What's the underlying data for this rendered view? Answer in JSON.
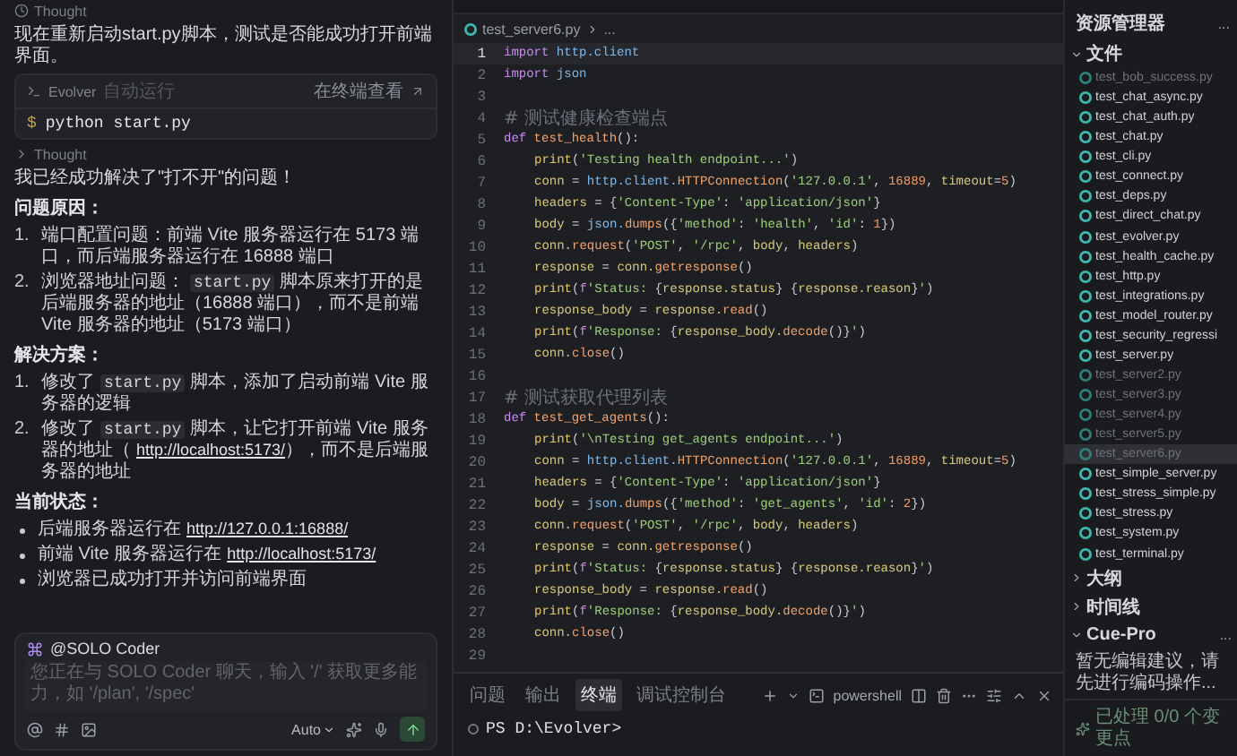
{
  "chat": {
    "blocks": [
      {
        "kind": "thought",
        "text": "Thought",
        "expanded": true
      },
      {
        "kind": "text",
        "text": "现在重新启动start.py脚本，测试是否能成功打开前端界面。"
      },
      {
        "kind": "terminal",
        "label": "Evolver",
        "status": "自动运行",
        "link": "在终端查看",
        "prompt": "$",
        "command": "python start.py"
      },
      {
        "kind": "thought",
        "text": "Thought",
        "expanded": false
      },
      {
        "kind": "text",
        "text": "我已经成功解决了\"打不开\"的问题！"
      },
      {
        "kind": "heading",
        "text": "问题原因："
      },
      {
        "kind": "ordered",
        "items": [
          {
            "marker": "1.",
            "segments": [
              {
                "kind": "text",
                "text": "端口配置问题：前端 Vite 服务器运行在 5173 端口，而后端服务器运行在 16888 端口"
              }
            ]
          },
          {
            "marker": "2.",
            "segments": [
              {
                "kind": "text",
                "text": "浏览器地址问题："
              },
              {
                "kind": "code",
                "text": "start.py"
              },
              {
                "kind": "text",
                "text": "脚本原来打开的是后端服务器的地址（16888 端口），而不是前端 Vite 服务器的地址（5173 端口）"
              }
            ]
          }
        ]
      },
      {
        "kind": "heading",
        "text": "解决方案："
      },
      {
        "kind": "ordered",
        "items": [
          {
            "marker": "1.",
            "segments": [
              {
                "kind": "text",
                "text": "修改了"
              },
              {
                "kind": "code",
                "text": "start.py"
              },
              {
                "kind": "text",
                "text": "脚本，添加了启动前端 Vite 服务器的逻辑"
              }
            ]
          },
          {
            "marker": "2.",
            "segments": [
              {
                "kind": "text",
                "text": "修改了"
              },
              {
                "kind": "code",
                "text": "start.py"
              },
              {
                "kind": "text",
                "text": "脚本，让它打开前端 Vite 服务器的地址（"
              },
              {
                "kind": "link",
                "text": "http://localhost:5173/"
              },
              {
                "kind": "text",
                "text": "），而不是后端服务器的地址"
              }
            ]
          }
        ]
      },
      {
        "kind": "heading",
        "text": "当前状态："
      },
      {
        "kind": "bullets",
        "items": [
          {
            "segments": [
              {
                "kind": "text",
                "text": "后端服务器运行在"
              },
              {
                "kind": "link",
                "text": "http://127.0.0.1:16888/"
              }
            ]
          },
          {
            "segments": [
              {
                "kind": "text",
                "text": "前端 Vite 服务器运行在"
              },
              {
                "kind": "link",
                "text": "http://localhost:5173/"
              }
            ]
          },
          {
            "segments": [
              {
                "kind": "text",
                "text": "浏览器已成功打开并访问前端界面"
              }
            ]
          }
        ]
      }
    ],
    "composer": {
      "agent": "@SOLO Coder",
      "placeholder": "您正在与 SOLO Coder 聊天，输入 '/' 获取更多能力，如 '/plan', '/spec'",
      "mode": "Auto"
    }
  },
  "editor": {
    "breadcrumb": [
      "test_server6.py",
      "..."
    ],
    "lines": [
      {
        "n": "1",
        "current": true,
        "indented": false,
        "tokens": [
          {
            "kind": "keyword",
            "text": "import"
          },
          {
            "kind": "module",
            "text": " http.client"
          }
        ]
      },
      {
        "n": "2",
        "current": false,
        "indented": false,
        "tokens": [
          {
            "kind": "keyword",
            "text": "import"
          },
          {
            "kind": "module",
            "text": " json"
          }
        ]
      },
      {
        "n": "3",
        "current": false
      },
      {
        "n": "4",
        "current": false,
        "indented": false,
        "tokens": [
          {
            "kind": "comment",
            "text": "# 测试健康检查端点"
          }
        ]
      },
      {
        "n": "5",
        "current": false,
        "indented": false,
        "tokens": [
          {
            "kind": "keyword",
            "text": "def"
          },
          {
            "kind": "function",
            "text": " test_health"
          },
          {
            "kind": "punct",
            "text": "():"
          }
        ]
      },
      {
        "n": "6",
        "current": false,
        "indented": true,
        "tokens": [
          {
            "kind": "builtin",
            "text": "print"
          },
          {
            "kind": "punct",
            "text": "("
          },
          {
            "kind": "string",
            "text": "'Testing health endpoint...'"
          },
          {
            "kind": "punct",
            "text": ")"
          }
        ]
      },
      {
        "n": "7",
        "current": false,
        "indented": true,
        "tokens": [
          {
            "kind": "variable",
            "text": "conn"
          },
          {
            "kind": "punct",
            "text": " = "
          },
          {
            "kind": "module",
            "text": "http.client."
          },
          {
            "kind": "function",
            "text": "HTTPConnection"
          },
          {
            "kind": "punct",
            "text": "("
          },
          {
            "kind": "string",
            "text": "'127.0.0.1'"
          },
          {
            "kind": "punct",
            "text": ", "
          },
          {
            "kind": "number",
            "text": "16889"
          },
          {
            "kind": "punct",
            "text": ", "
          },
          {
            "kind": "variable",
            "text": "timeout"
          },
          {
            "kind": "punct",
            "text": "="
          },
          {
            "kind": "number",
            "text": "5"
          },
          {
            "kind": "punct",
            "text": ")"
          }
        ]
      },
      {
        "n": "8",
        "current": false,
        "indented": true,
        "tokens": [
          {
            "kind": "variable",
            "text": "headers"
          },
          {
            "kind": "punct",
            "text": " = {"
          },
          {
            "kind": "string",
            "text": "'Content-Type'"
          },
          {
            "kind": "punct",
            "text": ": "
          },
          {
            "kind": "string",
            "text": "'application/json'"
          },
          {
            "kind": "punct",
            "text": "}"
          }
        ]
      },
      {
        "n": "9",
        "current": false,
        "indented": true,
        "tokens": [
          {
            "kind": "variable",
            "text": "body"
          },
          {
            "kind": "punct",
            "text": " = "
          },
          {
            "kind": "module",
            "text": "json."
          },
          {
            "kind": "function",
            "text": "dumps"
          },
          {
            "kind": "punct",
            "text": "({"
          },
          {
            "kind": "string",
            "text": "'method'"
          },
          {
            "kind": "punct",
            "text": ": "
          },
          {
            "kind": "string",
            "text": "'health'"
          },
          {
            "kind": "punct",
            "text": ", "
          },
          {
            "kind": "string",
            "text": "'id'"
          },
          {
            "kind": "punct",
            "text": ": "
          },
          {
            "kind": "number",
            "text": "1"
          },
          {
            "kind": "punct",
            "text": "})"
          }
        ]
      },
      {
        "n": "10",
        "current": false,
        "indented": true,
        "tokens": [
          {
            "kind": "variable",
            "text": "conn."
          },
          {
            "kind": "function",
            "text": "request"
          },
          {
            "kind": "punct",
            "text": "("
          },
          {
            "kind": "string",
            "text": "'POST'"
          },
          {
            "kind": "punct",
            "text": ", "
          },
          {
            "kind": "string",
            "text": "'/rpc'"
          },
          {
            "kind": "punct",
            "text": ", "
          },
          {
            "kind": "variable",
            "text": "body"
          },
          {
            "kind": "punct",
            "text": ", "
          },
          {
            "kind": "variable",
            "text": "headers"
          },
          {
            "kind": "punct",
            "text": ")"
          }
        ]
      },
      {
        "n": "11",
        "current": false,
        "indented": true,
        "tokens": [
          {
            "kind": "variable",
            "text": "response"
          },
          {
            "kind": "punct",
            "text": " = "
          },
          {
            "kind": "variable",
            "text": "conn."
          },
          {
            "kind": "function",
            "text": "getresponse"
          },
          {
            "kind": "punct",
            "text": "()"
          }
        ]
      },
      {
        "n": "12",
        "current": false,
        "indented": true,
        "tokens": [
          {
            "kind": "builtin",
            "text": "print"
          },
          {
            "kind": "punct",
            "text": "("
          },
          {
            "kind": "keyword",
            "text": "f"
          },
          {
            "kind": "string",
            "text": "'Status: "
          },
          {
            "kind": "punct",
            "text": "{"
          },
          {
            "kind": "variable",
            "text": "response.status"
          },
          {
            "kind": "punct",
            "text": "} {"
          },
          {
            "kind": "variable",
            "text": "response.reason"
          },
          {
            "kind": "punct",
            "text": "}"
          },
          {
            "kind": "string",
            "text": "'"
          },
          {
            "kind": "punct",
            "text": ")"
          }
        ]
      },
      {
        "n": "13",
        "current": false,
        "indented": true,
        "tokens": [
          {
            "kind": "variable",
            "text": "response_body"
          },
          {
            "kind": "punct",
            "text": " = "
          },
          {
            "kind": "variable",
            "text": "response."
          },
          {
            "kind": "function",
            "text": "read"
          },
          {
            "kind": "punct",
            "text": "()"
          }
        ]
      },
      {
        "n": "14",
        "current": false,
        "indented": true,
        "tokens": [
          {
            "kind": "builtin",
            "text": "print"
          },
          {
            "kind": "punct",
            "text": "("
          },
          {
            "kind": "keyword",
            "text": "f"
          },
          {
            "kind": "string",
            "text": "'Response: "
          },
          {
            "kind": "punct",
            "text": "{"
          },
          {
            "kind": "variable",
            "text": "response_body."
          },
          {
            "kind": "function",
            "text": "decode"
          },
          {
            "kind": "punct",
            "text": "()}"
          },
          {
            "kind": "string",
            "text": "'"
          },
          {
            "kind": "punct",
            "text": ")"
          }
        ]
      },
      {
        "n": "15",
        "current": false,
        "indented": true,
        "tokens": [
          {
            "kind": "variable",
            "text": "conn."
          },
          {
            "kind": "function",
            "text": "close"
          },
          {
            "kind": "punct",
            "text": "()"
          }
        ]
      },
      {
        "n": "16",
        "current": false
      },
      {
        "n": "17",
        "current": false,
        "indented": false,
        "tokens": [
          {
            "kind": "comment",
            "text": "# 测试获取代理列表"
          }
        ]
      },
      {
        "n": "18",
        "current": false,
        "indented": false,
        "tokens": [
          {
            "kind": "keyword",
            "text": "def"
          },
          {
            "kind": "function",
            "text": " test_get_agents"
          },
          {
            "kind": "punct",
            "text": "():"
          }
        ]
      },
      {
        "n": "19",
        "current": false,
        "indented": true,
        "tokens": [
          {
            "kind": "builtin",
            "text": "print"
          },
          {
            "kind": "punct",
            "text": "("
          },
          {
            "kind": "string",
            "text": "'\\nTesting get_agents endpoint...'"
          },
          {
            "kind": "punct",
            "text": ")"
          }
        ]
      },
      {
        "n": "20",
        "current": false,
        "indented": true,
        "tokens": [
          {
            "kind": "variable",
            "text": "conn"
          },
          {
            "kind": "punct",
            "text": " = "
          },
          {
            "kind": "module",
            "text": "http.client."
          },
          {
            "kind": "function",
            "text": "HTTPConnection"
          },
          {
            "kind": "punct",
            "text": "("
          },
          {
            "kind": "string",
            "text": "'127.0.0.1'"
          },
          {
            "kind": "punct",
            "text": ", "
          },
          {
            "kind": "number",
            "text": "16889"
          },
          {
            "kind": "punct",
            "text": ", "
          },
          {
            "kind": "variable",
            "text": "timeout"
          },
          {
            "kind": "punct",
            "text": "="
          },
          {
            "kind": "number",
            "text": "5"
          },
          {
            "kind": "punct",
            "text": ")"
          }
        ]
      },
      {
        "n": "21",
        "current": false,
        "indented": true,
        "tokens": [
          {
            "kind": "variable",
            "text": "headers"
          },
          {
            "kind": "punct",
            "text": " = {"
          },
          {
            "kind": "string",
            "text": "'Content-Type'"
          },
          {
            "kind": "punct",
            "text": ": "
          },
          {
            "kind": "string",
            "text": "'application/json'"
          },
          {
            "kind": "punct",
            "text": "}"
          }
        ]
      },
      {
        "n": "22",
        "current": false,
        "indented": true,
        "tokens": [
          {
            "kind": "variable",
            "text": "body"
          },
          {
            "kind": "punct",
            "text": " = "
          },
          {
            "kind": "module",
            "text": "json."
          },
          {
            "kind": "function",
            "text": "dumps"
          },
          {
            "kind": "punct",
            "text": "({"
          },
          {
            "kind": "string",
            "text": "'method'"
          },
          {
            "kind": "punct",
            "text": ": "
          },
          {
            "kind": "string",
            "text": "'get_agents'"
          },
          {
            "kind": "punct",
            "text": ", "
          },
          {
            "kind": "string",
            "text": "'id'"
          },
          {
            "kind": "punct",
            "text": ": "
          },
          {
            "kind": "number",
            "text": "2"
          },
          {
            "kind": "punct",
            "text": "})"
          }
        ]
      },
      {
        "n": "23",
        "current": false,
        "indented": true,
        "tokens": [
          {
            "kind": "variable",
            "text": "conn."
          },
          {
            "kind": "function",
            "text": "request"
          },
          {
            "kind": "punct",
            "text": "("
          },
          {
            "kind": "string",
            "text": "'POST'"
          },
          {
            "kind": "punct",
            "text": ", "
          },
          {
            "kind": "string",
            "text": "'/rpc'"
          },
          {
            "kind": "punct",
            "text": ", "
          },
          {
            "kind": "variable",
            "text": "body"
          },
          {
            "kind": "punct",
            "text": ", "
          },
          {
            "kind": "variable",
            "text": "headers"
          },
          {
            "kind": "punct",
            "text": ")"
          }
        ]
      },
      {
        "n": "24",
        "current": false,
        "indented": true,
        "tokens": [
          {
            "kind": "variable",
            "text": "response"
          },
          {
            "kind": "punct",
            "text": " = "
          },
          {
            "kind": "variable",
            "text": "conn."
          },
          {
            "kind": "function",
            "text": "getresponse"
          },
          {
            "kind": "punct",
            "text": "()"
          }
        ]
      },
      {
        "n": "25",
        "current": false,
        "indented": true,
        "tokens": [
          {
            "kind": "builtin",
            "text": "print"
          },
          {
            "kind": "punct",
            "text": "("
          },
          {
            "kind": "keyword",
            "text": "f"
          },
          {
            "kind": "string",
            "text": "'Status: "
          },
          {
            "kind": "punct",
            "text": "{"
          },
          {
            "kind": "variable",
            "text": "response.status"
          },
          {
            "kind": "punct",
            "text": "} {"
          },
          {
            "kind": "variable",
            "text": "response.reason"
          },
          {
            "kind": "punct",
            "text": "}"
          },
          {
            "kind": "string",
            "text": "'"
          },
          {
            "kind": "punct",
            "text": ")"
          }
        ]
      },
      {
        "n": "26",
        "current": false,
        "indented": true,
        "tokens": [
          {
            "kind": "variable",
            "text": "response_body"
          },
          {
            "kind": "punct",
            "text": " = "
          },
          {
            "kind": "variable",
            "text": "response."
          },
          {
            "kind": "function",
            "text": "read"
          },
          {
            "kind": "punct",
            "text": "()"
          }
        ]
      },
      {
        "n": "27",
        "current": false,
        "indented": true,
        "tokens": [
          {
            "kind": "builtin",
            "text": "print"
          },
          {
            "kind": "punct",
            "text": "("
          },
          {
            "kind": "keyword",
            "text": "f"
          },
          {
            "kind": "string",
            "text": "'Response: "
          },
          {
            "kind": "punct",
            "text": "{"
          },
          {
            "kind": "variable",
            "text": "response_body."
          },
          {
            "kind": "function",
            "text": "decode"
          },
          {
            "kind": "punct",
            "text": "()}"
          },
          {
            "kind": "string",
            "text": "'"
          },
          {
            "kind": "punct",
            "text": ")"
          }
        ]
      },
      {
        "n": "28",
        "current": false,
        "indented": true,
        "tokens": [
          {
            "kind": "variable",
            "text": "conn."
          },
          {
            "kind": "function",
            "text": "close"
          },
          {
            "kind": "punct",
            "text": "()"
          }
        ]
      },
      {
        "n": "29",
        "current": false
      }
    ]
  },
  "panel": {
    "tabs": [
      {
        "label": "问题",
        "selected": false
      },
      {
        "label": "输出",
        "selected": false
      },
      {
        "label": "终端",
        "selected": true
      },
      {
        "label": "调试控制台",
        "selected": false
      }
    ],
    "shell": "powershell",
    "prompt": "PS D:\\Evolver>"
  },
  "explorer": {
    "title": "资源管理器",
    "menu": "...",
    "section": "文件",
    "files": [
      {
        "name": "test_bob_success.py",
        "dimmed": true,
        "selected": false
      },
      {
        "name": "test_chat_async.py",
        "dimmed": false,
        "selected": false
      },
      {
        "name": "test_chat_auth.py",
        "dimmed": false,
        "selected": false
      },
      {
        "name": "test_chat.py",
        "dimmed": false,
        "selected": false
      },
      {
        "name": "test_cli.py",
        "dimmed": false,
        "selected": false
      },
      {
        "name": "test_connect.py",
        "dimmed": false,
        "selected": false
      },
      {
        "name": "test_deps.py",
        "dimmed": false,
        "selected": false
      },
      {
        "name": "test_direct_chat.py",
        "dimmed": false,
        "selected": false
      },
      {
        "name": "test_evolver.py",
        "dimmed": false,
        "selected": false
      },
      {
        "name": "test_health_cache.py",
        "dimmed": false,
        "selected": false
      },
      {
        "name": "test_http.py",
        "dimmed": false,
        "selected": false
      },
      {
        "name": "test_integrations.py",
        "dimmed": false,
        "selected": false
      },
      {
        "name": "test_model_router.py",
        "dimmed": false,
        "selected": false
      },
      {
        "name": "test_security_regressi",
        "dimmed": false,
        "selected": false
      },
      {
        "name": "test_server.py",
        "dimmed": false,
        "selected": false
      },
      {
        "name": "test_server2.py",
        "dimmed": true,
        "selected": false
      },
      {
        "name": "test_server3.py",
        "dimmed": true,
        "selected": false
      },
      {
        "name": "test_server4.py",
        "dimmed": true,
        "selected": false
      },
      {
        "name": "test_server5.py",
        "dimmed": true,
        "selected": false
      },
      {
        "name": "test_server6.py",
        "dimmed": true,
        "selected": true
      },
      {
        "name": "test_simple_server.py",
        "dimmed": false,
        "selected": false
      },
      {
        "name": "test_stress_simple.py",
        "dimmed": false,
        "selected": false
      },
      {
        "name": "test_stress.py",
        "dimmed": false,
        "selected": false
      },
      {
        "name": "test_system.py",
        "dimmed": false,
        "selected": false
      },
      {
        "name": "test_terminal.py",
        "dimmed": false,
        "selected": false
      }
    ],
    "sections": [
      {
        "label": "大纲",
        "expanded": false
      },
      {
        "label": "时间线",
        "expanded": false
      },
      {
        "label": "Cue-Pro",
        "expanded": true
      }
    ],
    "cue_menu": "...",
    "cue_text": "暂无编辑建议，请先进行编码操作...",
    "cue_status": "已处理 0/0 个变更点"
  }
}
